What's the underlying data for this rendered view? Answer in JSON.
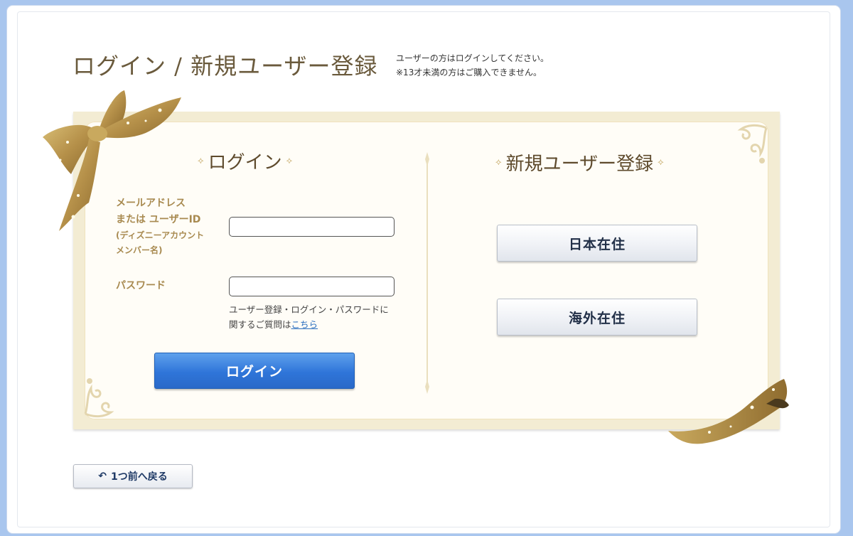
{
  "header": {
    "title": "ログイン / 新規ユーザー登録",
    "notes": [
      "ユーザーの方はログインしてください。",
      "※13才未満の方はご購入できません。"
    ]
  },
  "login": {
    "heading": "ログイン",
    "id_label_lines": [
      "メールアドレス",
      "または ユーザーID"
    ],
    "id_label_sub_lines": [
      "(ディズニーアカウント",
      "メンバー名)"
    ],
    "id_value": "",
    "password_label": "パスワード",
    "password_value": "",
    "help_text": "ユーザー登録・ログイン・パスワードに関するご質問は",
    "help_link": "こちら",
    "submit_label": "ログイン"
  },
  "register": {
    "heading": "新規ユーザー登録",
    "japan_label": "日本在住",
    "overseas_label": "海外在住"
  },
  "back": {
    "label": "1つ前へ戻る"
  },
  "colors": {
    "background": "#a9c6ee",
    "gold": "#a88a50",
    "primary_button": "#2f75d9"
  }
}
